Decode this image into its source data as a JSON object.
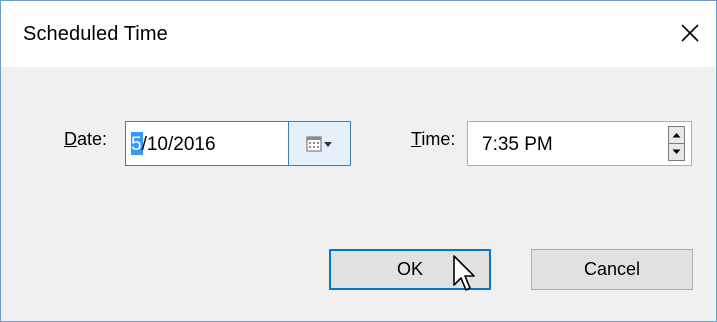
{
  "dialog": {
    "title": "Scheduled Time",
    "close_icon": "close-icon"
  },
  "date": {
    "label_accel": "D",
    "label_rest": "ate:",
    "value_selected": "5",
    "value_rest": "/10/2016",
    "picker_icon": "calendar-dropdown-icon"
  },
  "time": {
    "label_accel": "T",
    "label_rest": "ime:",
    "value": "7:35 PM",
    "spin_up_icon": "spin-up-icon",
    "spin_down_icon": "spin-down-icon"
  },
  "buttons": {
    "ok": "OK",
    "cancel": "Cancel"
  },
  "colors": {
    "accent": "#0078d7",
    "selection": "#3399ff",
    "dialog_bg": "#f0f0f0"
  }
}
